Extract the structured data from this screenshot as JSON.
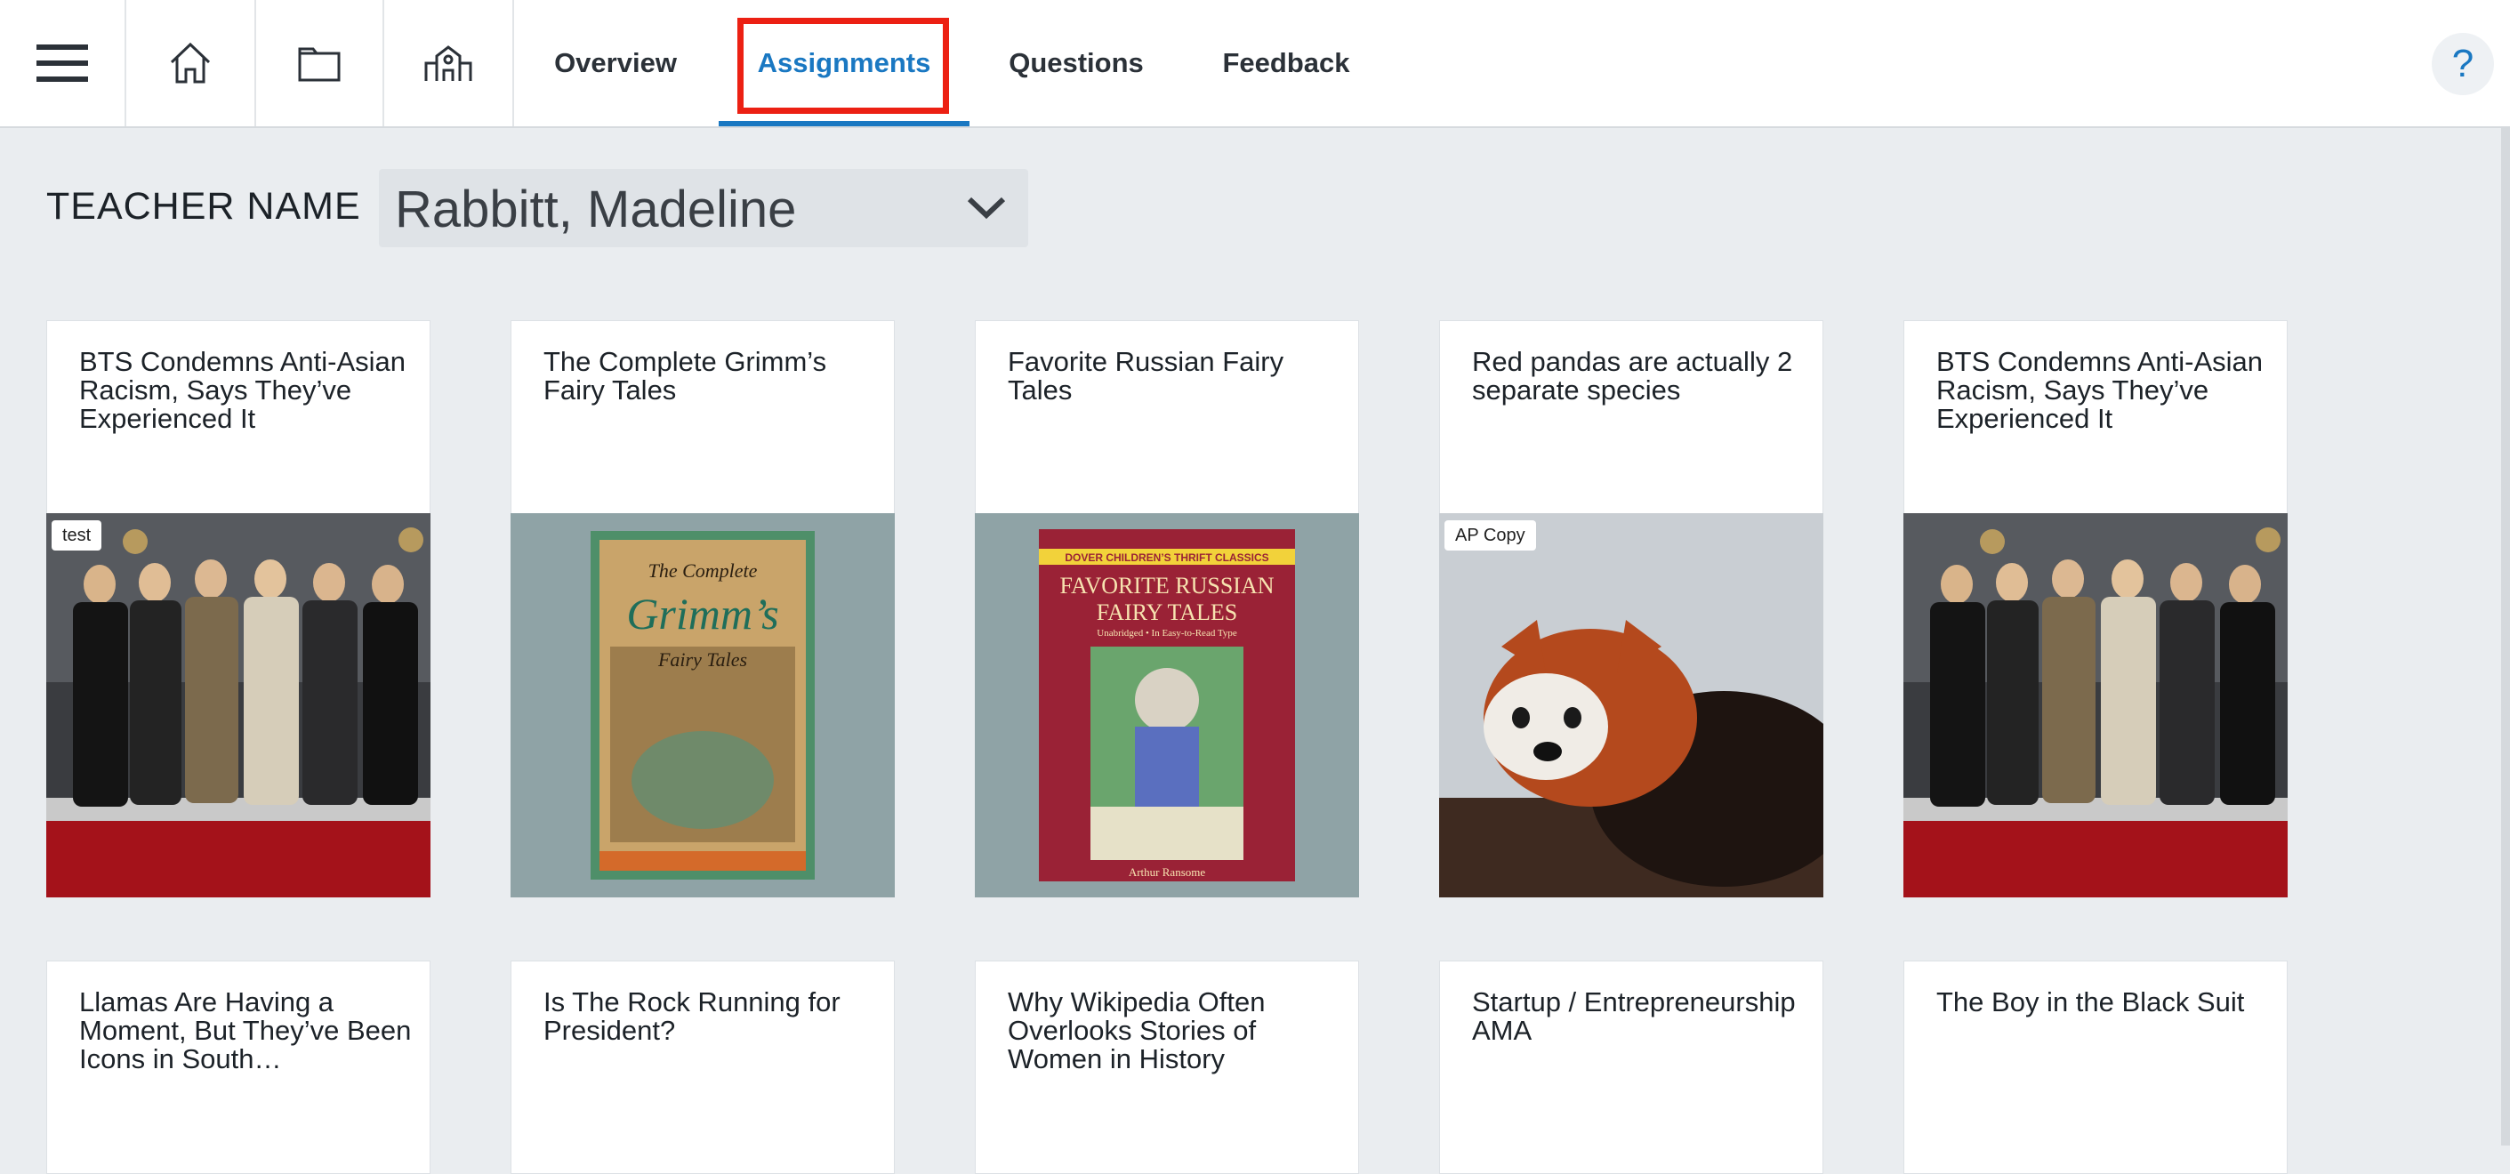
{
  "nav": {
    "icons": [
      {
        "name": "menu-icon"
      },
      {
        "name": "home-icon"
      },
      {
        "name": "folder-icon"
      },
      {
        "name": "school-icon"
      }
    ],
    "tabs": [
      {
        "label": "Overview"
      },
      {
        "label": "Assignments",
        "active": true
      },
      {
        "label": "Questions"
      },
      {
        "label": "Feedback"
      }
    ],
    "help_label": "?",
    "accent_color": "#1a78c2",
    "highlight_color": "#ec2013"
  },
  "teacher": {
    "label": "TEACHER NAME",
    "selected": "Rabbitt, Madeline"
  },
  "cards": [
    {
      "title": "BTS Condemns Anti-Asian Racism, Says They’ve Experienced It",
      "badge": "test",
      "image": "bts-photo"
    },
    {
      "title": "The Complete Grimm’s Fairy Tales",
      "badge": "",
      "image": "grimm-book-cover"
    },
    {
      "title": "Favorite Russian Fairy Tales",
      "badge": "",
      "image": "russian-fairy-tales-cover"
    },
    {
      "title": "Red pandas are actually 2 separate species",
      "badge": "AP Copy",
      "image": "red-panda-photo"
    },
    {
      "title": "BTS Condemns Anti-Asian Racism, Says They’ve Experienced It",
      "badge": "",
      "image": "bts-photo"
    },
    {
      "title": "Llamas Are Having a Moment, But They’ve Been Icons in South…"
    },
    {
      "title": "Is The Rock Running for President?"
    },
    {
      "title": "Why Wikipedia Often Overlooks Stories of Women in History"
    },
    {
      "title": "Startup / Entrepreneurship AMA"
    },
    {
      "title": "The Boy in the Black Suit"
    }
  ],
  "book_covers": {
    "grimm": {
      "line1": "The Complete",
      "line2": "Grimm’s",
      "line3": "Fairy Tales"
    },
    "russian": {
      "series": "DOVER CHILDREN’S THRIFT CLASSICS",
      "title1": "FAVORITE RUSSIAN",
      "title2": "FAIRY TALES",
      "subtitle": "Unabridged • In Easy-to-Read Type",
      "author": "Arthur Ransome"
    }
  }
}
